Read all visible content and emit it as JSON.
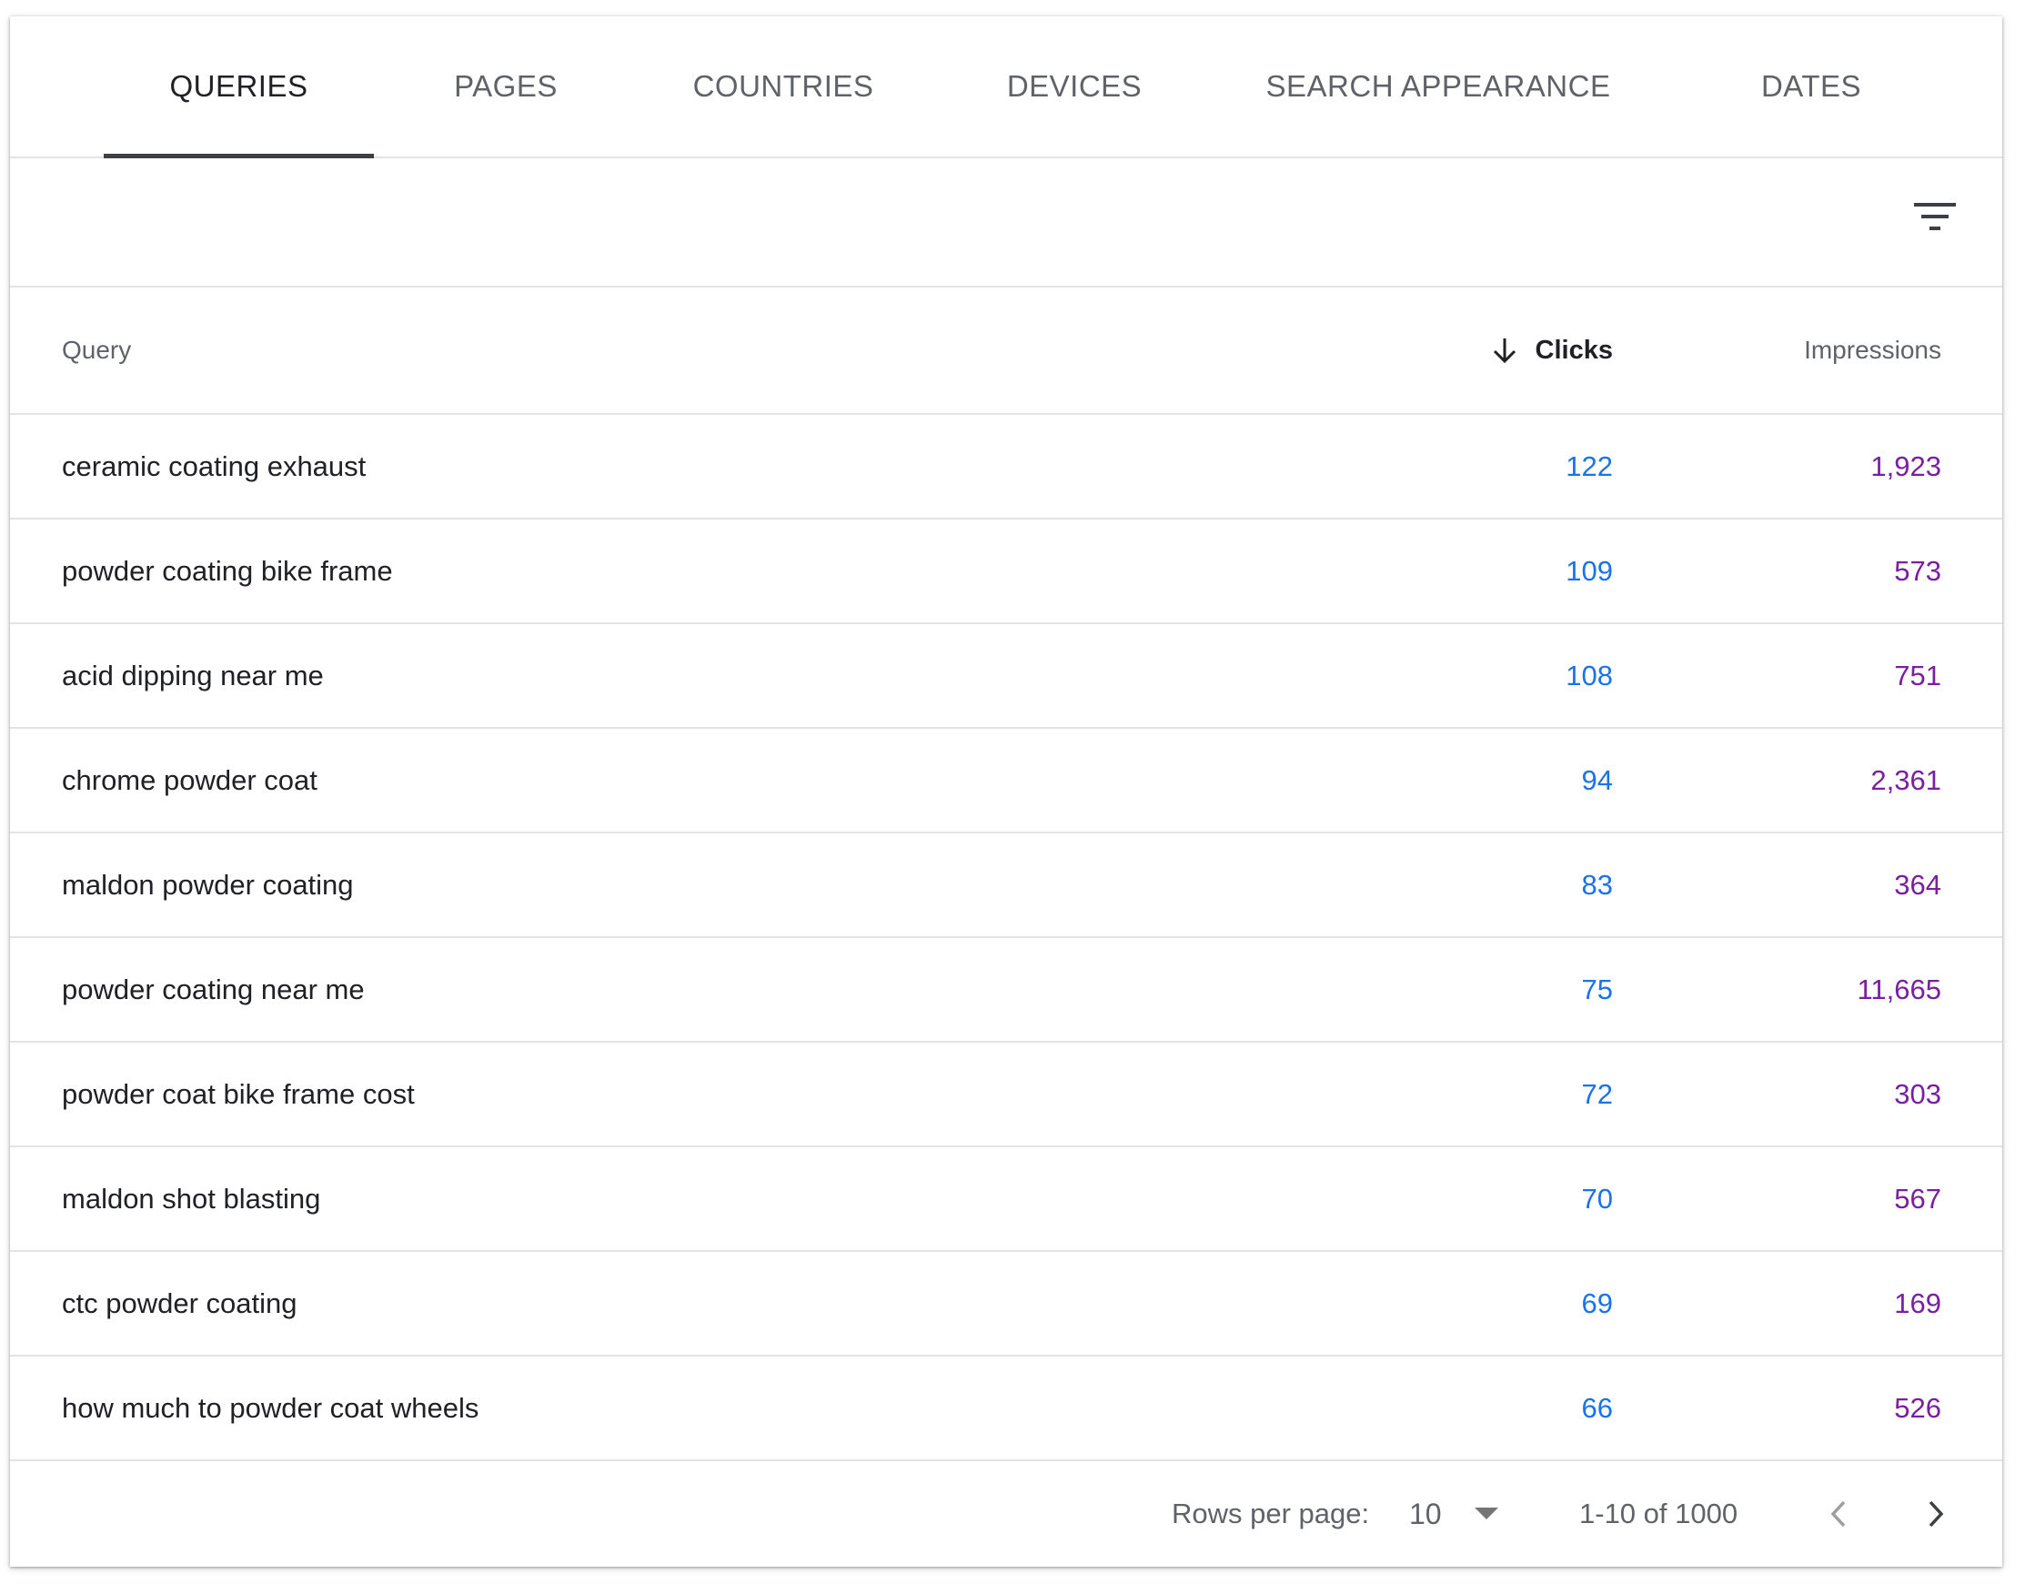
{
  "tabs": [
    {
      "label": "QUERIES",
      "active": true
    },
    {
      "label": "PAGES",
      "active": false
    },
    {
      "label": "COUNTRIES",
      "active": false
    },
    {
      "label": "DEVICES",
      "active": false
    },
    {
      "label": "SEARCH APPEARANCE",
      "active": false
    },
    {
      "label": "DATES",
      "active": false
    }
  ],
  "toolbar": {
    "filter_icon": "filter-list-icon"
  },
  "table": {
    "headers": {
      "query": "Query",
      "clicks": "Clicks",
      "impressions": "Impressions"
    },
    "sort": {
      "column": "clicks",
      "direction": "descending",
      "icon": "arrow-down-icon"
    },
    "rows": [
      {
        "query": "ceramic coating exhaust",
        "clicks": "122",
        "impressions": "1,923"
      },
      {
        "query": "powder coating bike frame",
        "clicks": "109",
        "impressions": "573"
      },
      {
        "query": "acid dipping near me",
        "clicks": "108",
        "impressions": "751"
      },
      {
        "query": "chrome powder coat",
        "clicks": "94",
        "impressions": "2,361"
      },
      {
        "query": "maldon powder coating",
        "clicks": "83",
        "impressions": "364"
      },
      {
        "query": "powder coating near me",
        "clicks": "75",
        "impressions": "11,665"
      },
      {
        "query": "powder coat bike frame cost",
        "clicks": "72",
        "impressions": "303"
      },
      {
        "query": "maldon shot blasting",
        "clicks": "70",
        "impressions": "567"
      },
      {
        "query": "ctc powder coating",
        "clicks": "69",
        "impressions": "169"
      },
      {
        "query": "how much to powder coat wheels",
        "clicks": "66",
        "impressions": "526"
      }
    ]
  },
  "footer": {
    "rows_per_page_label": "Rows per page:",
    "rows_per_page_value": "10",
    "range": "1-10 of 1000"
  },
  "colors": {
    "clicks": "#1a73e8",
    "impressions": "#7b1fa2",
    "active_tab_ink": "#3c4043"
  }
}
